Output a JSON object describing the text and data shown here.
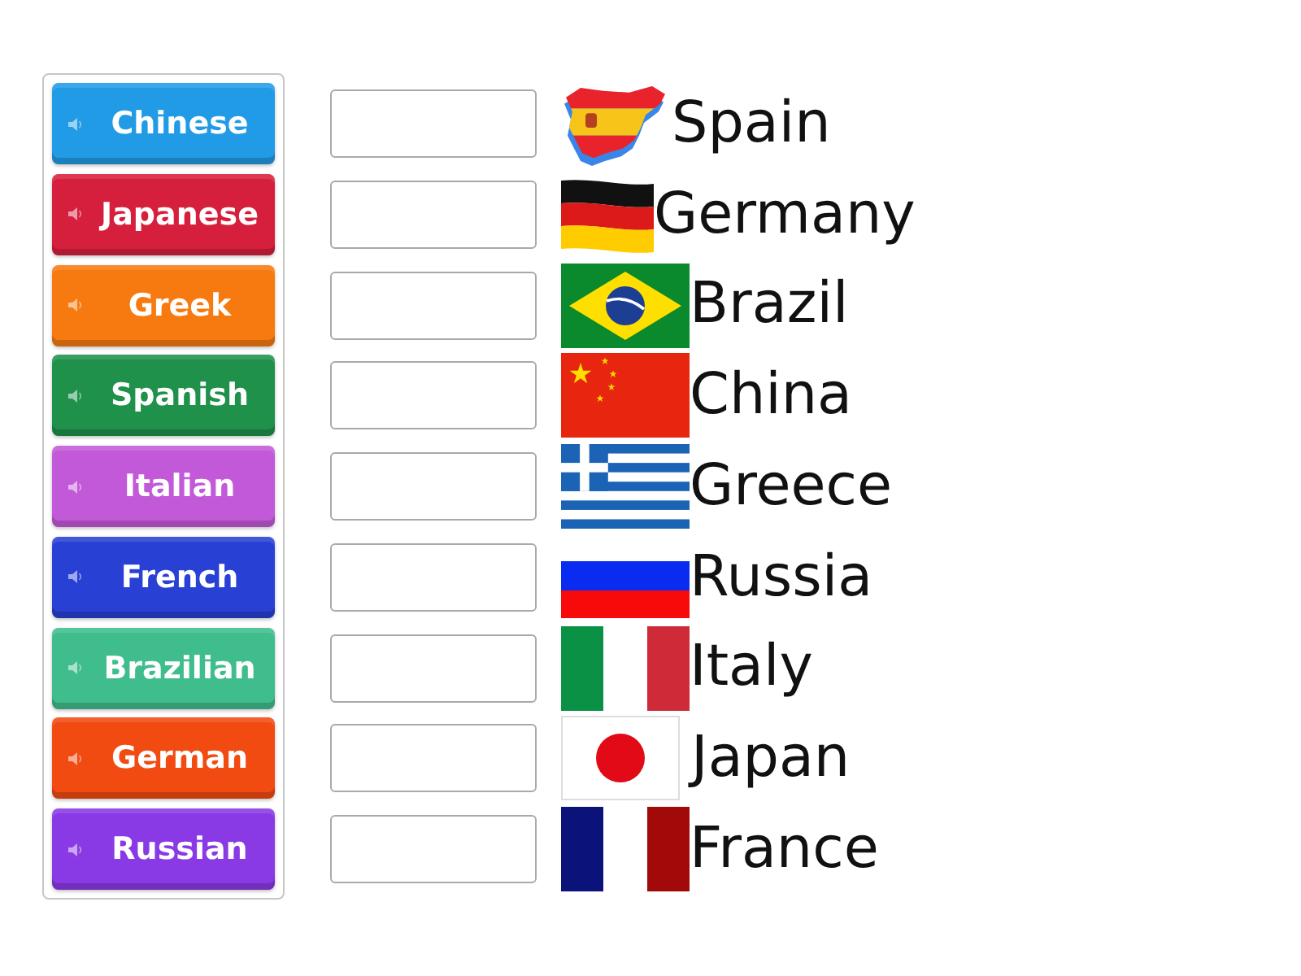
{
  "tiles": [
    {
      "label": "Chinese",
      "color": "#219be6"
    },
    {
      "label": "Japanese",
      "color": "#d61f3c"
    },
    {
      "label": "Greek",
      "color": "#f77a10"
    },
    {
      "label": "Spanish",
      "color": "#1f914a"
    },
    {
      "label": "Italian",
      "color": "#c259d8"
    },
    {
      "label": "French",
      "color": "#2840d4"
    },
    {
      "label": "Brazilian",
      "color": "#40bd8c"
    },
    {
      "label": "German",
      "color": "#f14b12"
    },
    {
      "label": "Russian",
      "color": "#8a3ae4"
    }
  ],
  "targets": [
    {
      "country": "Spain"
    },
    {
      "country": "Germany"
    },
    {
      "country": "Brazil"
    },
    {
      "country": "China"
    },
    {
      "country": "Greece"
    },
    {
      "country": "Russia"
    },
    {
      "country": "Italy"
    },
    {
      "country": "Japan"
    },
    {
      "country": "France"
    }
  ]
}
